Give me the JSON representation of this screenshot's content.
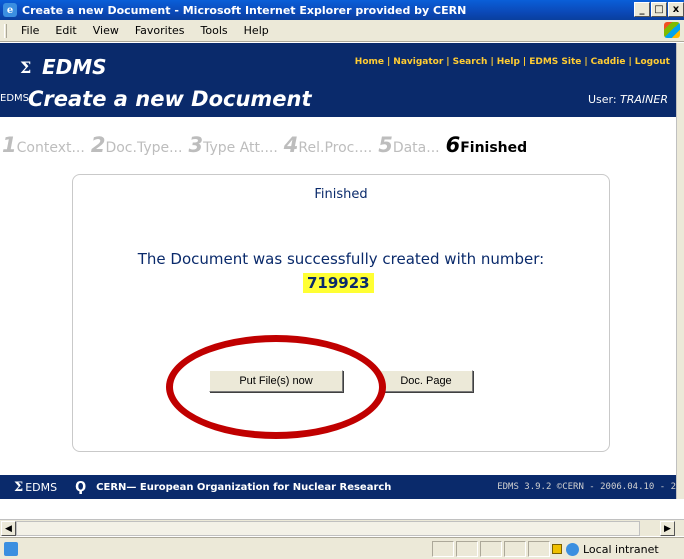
{
  "window": {
    "title": "Create a new Document - Microsoft Internet Explorer provided by CERN",
    "min_label": "_",
    "max_label": "□",
    "close_label": "x"
  },
  "menu": [
    "File",
    "Edit",
    "View",
    "Favorites",
    "Tools",
    "Help"
  ],
  "header": {
    "brand": "EDMS",
    "sigma": "Σ",
    "small_brand": "EDMS",
    "page_title": "Create a new Document",
    "user_label": "User:",
    "user_name": "TRAINER",
    "links": [
      "Home",
      "Navigator",
      "Search",
      "Help",
      "EDMS Site",
      "Caddie",
      "Logout"
    ]
  },
  "steps": [
    {
      "num": "1",
      "label": "Context..."
    },
    {
      "num": "2",
      "label": "Doc.Type..."
    },
    {
      "num": "3",
      "label": "Type Att...."
    },
    {
      "num": "4",
      "label": "Rel.Proc...."
    },
    {
      "num": "5",
      "label": "Data..."
    },
    {
      "num": "6",
      "label": "Finished"
    }
  ],
  "panel": {
    "title": "Finished",
    "message": "The Document was successfully created with number:",
    "doc_number": "719923",
    "put_files_button": "Put File(s) now",
    "doc_page_button": "Doc. Page"
  },
  "footer": {
    "edms": "EDMS",
    "cern_logo": "Ϙ",
    "cern_text": "CERN— European Organization for Nuclear Research",
    "version": "EDMS 3.9.2 ©CERN - 2006.04.10 - 2"
  },
  "status": {
    "zone": "Local intranet"
  },
  "colors": {
    "header_bg": "#0a2a6b",
    "highlight": "#ffff33",
    "annotation": "#c00000",
    "links": "#ffcc33"
  }
}
